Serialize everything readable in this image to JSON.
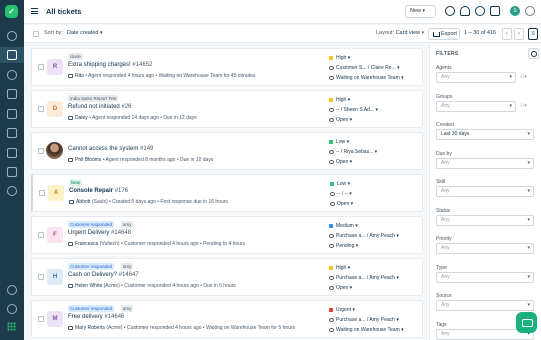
{
  "topbar": {
    "title": "All tickets",
    "new_label": "New",
    "avatar_initial": "S"
  },
  "toolbar": {
    "sort_label": "Sort by:",
    "sort_value": "Date created",
    "layout_label": "Layout:",
    "layout_value": "Card view",
    "export_label": "Export",
    "page_range": "1 – 30 of 416"
  },
  "tickets": [
    {
      "avatar": "R",
      "avatar_bg": "#ece2f7",
      "avatar_fg": "#7b5aa6",
      "tag": "claire",
      "tag_style": "plain",
      "tag2": "",
      "subject": "Extra shipping charges!",
      "number": "#14652",
      "requester": "Rita",
      "meta": " • Agent responded 4 hours ago • Waiting on Warehouse Team for 45 minutes",
      "priority": "High",
      "priority_color": "#f5c518",
      "assignee": "Customer S... / Claire Re...",
      "status": "Waiting on Warehouse Team",
      "bold": false,
      "unread": false
    },
    {
      "avatar": "D",
      "avatar_bg": "#fcebd9",
      "avatar_fg": "#c47a2c",
      "tag": "India Sales Report Test",
      "tag_style": "plain",
      "tag2": "",
      "subject": "Refund not initiated",
      "number": "#26",
      "requester": "Daley",
      "meta": " • Agent responded 14 days ago • Due in 12 days",
      "priority": "High",
      "priority_color": "#f5c518",
      "assignee": "-- / Sheen S Ad...",
      "status": "Open",
      "bold": false,
      "unread": false
    },
    {
      "avatar": "",
      "avatar_bg": "",
      "avatar_fg": "",
      "tag": "",
      "tag_style": "none",
      "tag2": "",
      "subject": "Cannot access the system",
      "number": "#149",
      "requester": "Phil Blooms",
      "meta": " • Agent responded 8 months ago • Due in 10 days",
      "priority": "Low",
      "priority_color": "#25c16f",
      "assignee": "-- / Riya Sebas...",
      "status": "Open",
      "bold": false,
      "unread": false,
      "photo": true
    },
    {
      "avatar": "A",
      "avatar_bg": "#fdf1c7",
      "avatar_fg": "#b3860f",
      "tag": "New",
      "tag_style": "green",
      "tag2": "",
      "subject": "Console Repair",
      "number": "#176",
      "requester": "Abbott",
      "meta": " (Sauls) • Created 5 days ago • First response due in 16 hours",
      "priority": "Low",
      "priority_color": "#25c16f",
      "assignee": "-- / --",
      "status": "Open",
      "bold": true,
      "unread": true
    },
    {
      "avatar": "F",
      "avatar_bg": "#fbe3ef",
      "avatar_fg": "#b54f84",
      "tag": "Customer responded",
      "tag_style": "blue",
      "tag2": "amy",
      "subject": "Urgent Delivery",
      "number": "#14648",
      "requester": "Francesca",
      "meta": " (Vultech) • Customer responded 4 hours ago • Pending to 4 hours",
      "priority": "Medium",
      "priority_color": "#2c8ae8",
      "assignee": "Purchase a... / Amy Peach",
      "status": "Pending",
      "bold": false,
      "unread": false
    },
    {
      "avatar": "H",
      "avatar_bg": "#dfeaf7",
      "avatar_fg": "#4a73a8",
      "tag": "Customer responded",
      "tag_style": "blue",
      "tag2": "amy",
      "subject": "Cash on Delivery?",
      "number": "#14647",
      "requester": "Helen White",
      "meta": " (Acme) • Customer responded 4 hours ago • Due in 6 hours",
      "priority": "High",
      "priority_color": "#f5c518",
      "assignee": "Purchase a... / Amy Peach",
      "status": "Open",
      "bold": false,
      "unread": false
    },
    {
      "avatar": "M",
      "avatar_bg": "#ece2f7",
      "avatar_fg": "#7b5aa6",
      "tag": "Customer responded",
      "tag_style": "blue",
      "tag2": "amy",
      "subject": "Free delivery",
      "number": "#14646",
      "requester": "Mary Roberts",
      "meta": " (Acme) • Customer responded 4 hours ago • Waiting on Warehouse Team for 5 hours",
      "priority": "Urgent",
      "priority_color": "#e43538",
      "assignee": "Purchase a... / Amy Peach",
      "status": "Waiting on Warehouse Team",
      "bold": false,
      "unread": false
    }
  ],
  "filters": {
    "heading": "FILTERS",
    "items": [
      {
        "label": "Agents",
        "value": "Any",
        "filled": false,
        "extra": ""
      },
      {
        "label": "Groups",
        "value": "Any",
        "filled": false,
        "extra": ""
      },
      {
        "label": "Created",
        "value": "Last 30 days",
        "filled": true,
        "extra": ""
      },
      {
        "label": "Due by",
        "value": "Any",
        "filled": false,
        "extra": ""
      },
      {
        "label": "Skill",
        "value": "Any",
        "filled": false,
        "extra": ""
      },
      {
        "label": "Status",
        "value": "Any",
        "filled": false,
        "extra": ""
      },
      {
        "label": "Priority",
        "value": "Any",
        "filled": false,
        "extra": ""
      },
      {
        "label": "Type",
        "value": "Any",
        "filled": false,
        "extra": ""
      },
      {
        "label": "Source",
        "value": "Any",
        "filled": false,
        "extra": ""
      },
      {
        "label": "Tags",
        "value": "Any",
        "filled": false,
        "extra": ""
      }
    ]
  },
  "icons": {
    "rail": [
      "logo-icon",
      "home-icon",
      "tickets-icon",
      "contacts-icon",
      "solutions-icon",
      "forums-icon",
      "analytics-icon",
      "automation-icon",
      "admin-icon",
      "phone-icon",
      "chat-icon",
      "apps-icon"
    ],
    "topbar": [
      "search-icon",
      "notifications-icon",
      "help-icon",
      "gift-icon",
      "refresh-icon"
    ]
  }
}
